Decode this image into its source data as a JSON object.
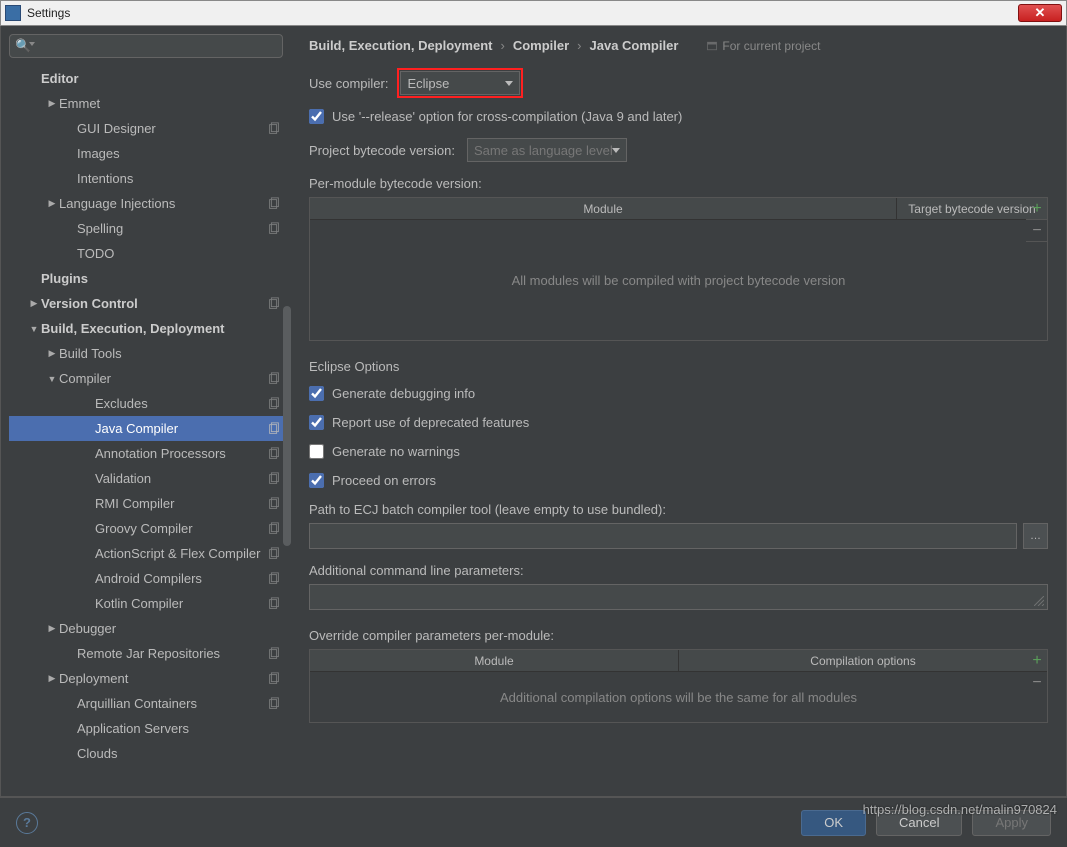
{
  "window": {
    "title": "Settings"
  },
  "search": {
    "placeholder": ""
  },
  "sidebar": {
    "headers": {
      "editor": "Editor",
      "plugins": "Plugins",
      "vcs": "Version Control",
      "bed": "Build, Execution, Deployment"
    },
    "items": {
      "emmet": "Emmet",
      "gui_designer": "GUI Designer",
      "images": "Images",
      "intentions": "Intentions",
      "lang_inj": "Language Injections",
      "spelling": "Spelling",
      "todo": "TODO",
      "build_tools": "Build Tools",
      "compiler": "Compiler",
      "excludes": "Excludes",
      "java_compiler": "Java Compiler",
      "annotation_proc": "Annotation Processors",
      "validation": "Validation",
      "rmi": "RMI Compiler",
      "groovy": "Groovy Compiler",
      "as_flex": "ActionScript & Flex Compiler",
      "android": "Android Compilers",
      "kotlin": "Kotlin Compiler",
      "debugger": "Debugger",
      "remote_jar": "Remote Jar Repositories",
      "deployment": "Deployment",
      "arquillian": "Arquillian Containers",
      "app_servers": "Application Servers",
      "clouds": "Clouds"
    }
  },
  "breadcrumb": {
    "a": "Build, Execution, Deployment",
    "b": "Compiler",
    "c": "Java Compiler",
    "hint": "For current project"
  },
  "main": {
    "use_compiler_label": "Use compiler:",
    "use_compiler_value": "Eclipse",
    "release_option": "Use '--release' option for cross-compilation (Java 9 and later)",
    "project_bytecode_label": "Project bytecode version:",
    "project_bytecode_value": "Same as language level",
    "per_module_label": "Per-module bytecode version:",
    "table1": {
      "col_module": "Module",
      "col_target": "Target bytecode version",
      "empty": "All modules will be compiled with project bytecode version"
    },
    "eclipse_title": "Eclipse Options",
    "chk_debug": "Generate debugging info",
    "chk_deprecated": "Report use of deprecated features",
    "chk_nowarn": "Generate no warnings",
    "chk_proceed": "Proceed on errors",
    "ecj_label": "Path to ECJ batch compiler tool (leave empty to use bundled):",
    "addl_label": "Additional command line parameters:",
    "override_label": "Override compiler parameters per-module:",
    "table2": {
      "col_module": "Module",
      "col_opts": "Compilation options",
      "empty": "Additional compilation options will be the same for all modules"
    }
  },
  "footer": {
    "ok": "OK",
    "cancel": "Cancel",
    "apply": "Apply"
  },
  "watermark": "https://blog.csdn.net/malin970824"
}
